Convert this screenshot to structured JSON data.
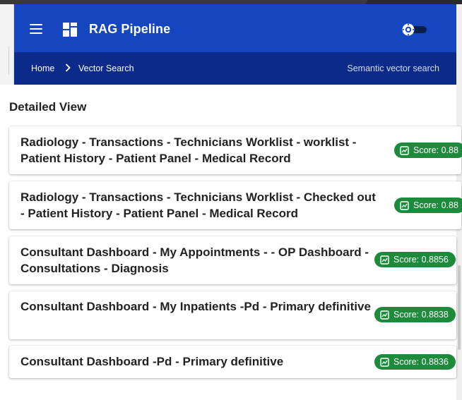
{
  "app": {
    "title": "RAG Pipeline"
  },
  "breadcrumb": {
    "home": "Home",
    "current": "Vector Search",
    "description": "Semantic vector search"
  },
  "section": {
    "title": "Detailed View"
  },
  "results": [
    {
      "title": "Radiology - Transactions - Technicians Worklist - worklist - Patient History - Patient Panel - Medical Record",
      "score": "Score: 0.88"
    },
    {
      "title": "Radiology - Transactions - Technicians Worklist - Checked out - Patient History - Patient Panel - Medical Record",
      "score": "Score: 0.88"
    },
    {
      "title": "Consultant Dashboard - My Appointments - - OP Dashboard -Consultations - Diagnosis",
      "score": "Score: 0.8856"
    },
    {
      "title": "Consultant Dashboard - My Inpatients -Pd - Primary definitive",
      "score": "Score: 0.8838"
    },
    {
      "title": "Consultant Dashboard -Pd - Primary definitive",
      "score": "Score: 0.8836"
    }
  ],
  "colors": {
    "app_bar": "#1546c0",
    "breadcrumb_bar": "#0b2a8a",
    "score_badge": "#1e8a3c"
  },
  "icons": [
    "menu-icon",
    "dashboard-icon",
    "theme-toggle-icon",
    "chevron-right-icon",
    "score-icon"
  ]
}
